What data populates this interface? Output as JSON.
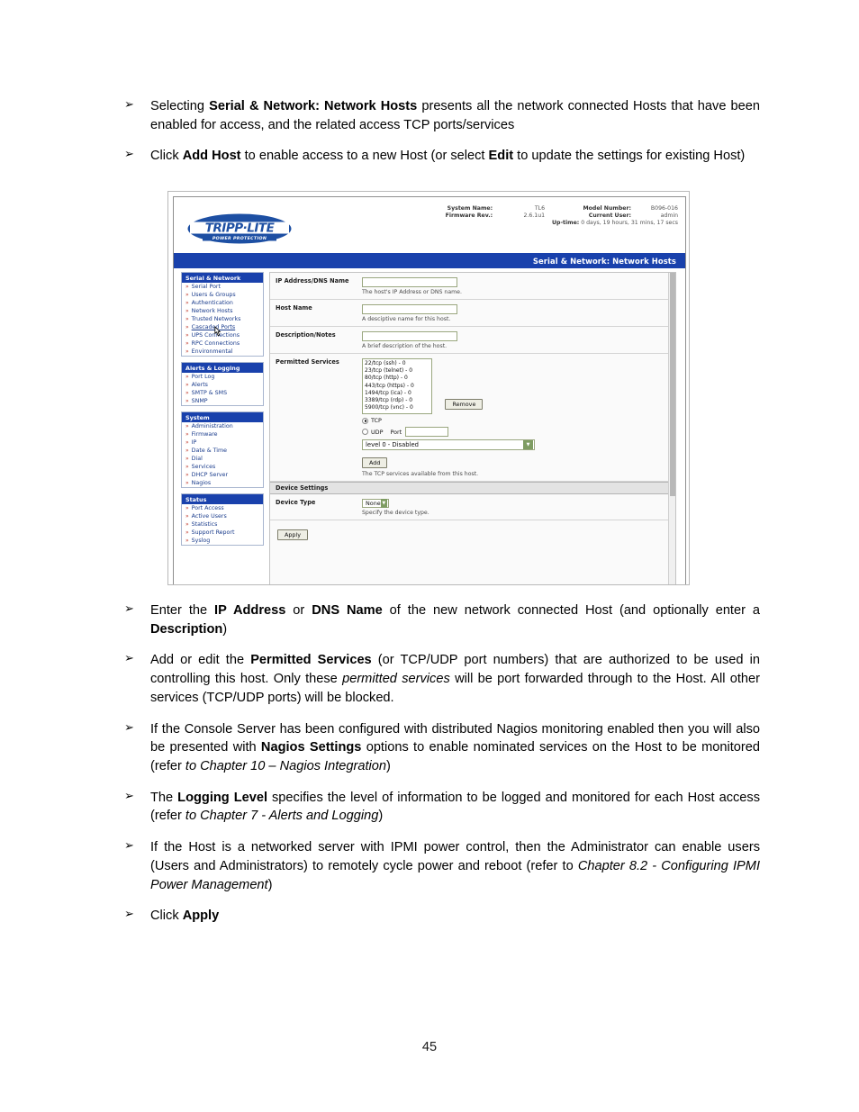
{
  "page": {
    "number": "45"
  },
  "bullets": [
    {
      "marker": "➢",
      "parts": [
        {
          "t": "Selecting ",
          "s": "n"
        },
        {
          "t": "Serial & Network: Network Hosts",
          "s": "b"
        },
        {
          "t": " presents all the network connected Hosts that have been enabled for access, and the related access TCP ports/services",
          "s": "n"
        }
      ]
    },
    {
      "marker": "➢",
      "parts": [
        {
          "t": "Click ",
          "s": "n"
        },
        {
          "t": "Add Host",
          "s": "b"
        },
        {
          "t": " to enable access to a new Host (or select ",
          "s": "n"
        },
        {
          "t": "Edit",
          "s": "b"
        },
        {
          "t": " to update the settings for existing Host)",
          "s": "n"
        }
      ]
    }
  ],
  "bullets_after": [
    {
      "marker": "➢",
      "parts": [
        {
          "t": "Enter the ",
          "s": "n"
        },
        {
          "t": "IP Address",
          "s": "b"
        },
        {
          "t": " or ",
          "s": "n"
        },
        {
          "t": "DNS Name",
          "s": "b"
        },
        {
          "t": " of the new network connected Host (and optionally enter a ",
          "s": "n"
        },
        {
          "t": "Description",
          "s": "b"
        },
        {
          "t": ")",
          "s": "n"
        }
      ]
    },
    {
      "marker": "➢",
      "parts": [
        {
          "t": "Add or edit the ",
          "s": "n"
        },
        {
          "t": "Permitted Services",
          "s": "b"
        },
        {
          "t": " (or TCP/UDP port numbers) that are authorized to be used in controlling this host. Only these ",
          "s": "n"
        },
        {
          "t": "permitted services",
          "s": "i"
        },
        {
          "t": " will be port forwarded through to the Host. All other services (TCP/UDP ports) will be blocked.",
          "s": "n"
        }
      ]
    },
    {
      "marker": "➢",
      "parts": [
        {
          "t": "If the Console Server has been configured with distributed Nagios monitoring enabled then you will also be presented with ",
          "s": "n"
        },
        {
          "t": "Nagios Settings",
          "s": "b"
        },
        {
          "t": " options to enable nominated services on the Host to be monitored (refer ",
          "s": "n"
        },
        {
          "t": "to Chapter 10 – Nagios Integration",
          "s": "i"
        },
        {
          "t": ")",
          "s": "n"
        }
      ]
    },
    {
      "marker": "➢",
      "parts": [
        {
          "t": "The ",
          "s": "n"
        },
        {
          "t": "Logging Level",
          "s": "b"
        },
        {
          "t": " specifies the level of information to be logged and monitored for each Host access (refer ",
          "s": "n"
        },
        {
          "t": "to Chapter 7 - Alerts and Logging",
          "s": "i"
        },
        {
          "t": ")",
          "s": "n"
        }
      ]
    },
    {
      "marker": "➢",
      "parts": [
        {
          "t": "If the Host is a networked server with IPMI power control, then the Administrator can enable users (Users and Administrators) to remotely cycle power and reboot (refer to ",
          "s": "n"
        },
        {
          "t": "Chapter 8.2 - Configuring IPMI Power Management",
          "s": "i"
        },
        {
          "t": ")",
          "s": "n"
        }
      ]
    },
    {
      "marker": "➢",
      "parts": [
        {
          "t": "Click ",
          "s": "n"
        },
        {
          "t": "Apply",
          "s": "b"
        }
      ]
    }
  ],
  "screenshot": {
    "brand": {
      "name": "TRIPP·LITE",
      "tagline": "POWER PROTECTION"
    },
    "system_info": {
      "system_name_label": "System Name:",
      "system_name_value": "TL6",
      "model_number_label": "Model Number:",
      "model_number_value": "B096-016",
      "firmware_label": "Firmware Rev.:",
      "firmware_value": "2.6.1u1",
      "current_user_label": "Current User:",
      "current_user_value": "admin",
      "uptime_label": "Up-time:",
      "uptime_value": "0 days, 19 hours, 31 mins, 17 secs"
    },
    "title_bar": "Serial & Network: Network Hosts",
    "sidebar": [
      {
        "header": "Serial & Network",
        "items": [
          {
            "label": "Serial Port",
            "hover": false
          },
          {
            "label": "Users & Groups",
            "hover": false
          },
          {
            "label": "Authentication",
            "hover": false
          },
          {
            "label": "Network Hosts",
            "hover": false
          },
          {
            "label": "Trusted Networks",
            "hover": false
          },
          {
            "label": "Cascaded Ports",
            "hover": true
          },
          {
            "label": "UPS Connections",
            "hover": false
          },
          {
            "label": "RPC Connections",
            "hover": false
          },
          {
            "label": "Environmental",
            "hover": false
          }
        ]
      },
      {
        "header": "Alerts & Logging",
        "items": [
          {
            "label": "Port Log",
            "hover": false
          },
          {
            "label": "Alerts",
            "hover": false
          },
          {
            "label": "SMTP & SMS",
            "hover": false
          },
          {
            "label": "SNMP",
            "hover": false
          }
        ]
      },
      {
        "header": "System",
        "items": [
          {
            "label": "Administration",
            "hover": false
          },
          {
            "label": "Firmware",
            "hover": false
          },
          {
            "label": "IP",
            "hover": false
          },
          {
            "label": "Date & Time",
            "hover": false
          },
          {
            "label": "Dial",
            "hover": false
          },
          {
            "label": "Services",
            "hover": false
          },
          {
            "label": "DHCP Server",
            "hover": false
          },
          {
            "label": "Nagios",
            "hover": false
          }
        ]
      },
      {
        "header": "Status",
        "items": [
          {
            "label": "Port Access",
            "hover": false
          },
          {
            "label": "Active Users",
            "hover": false
          },
          {
            "label": "Statistics",
            "hover": false
          },
          {
            "label": "Support Report",
            "hover": false
          },
          {
            "label": "Syslog",
            "hover": false
          }
        ]
      }
    ],
    "form": {
      "ip_label": "IP Address/DNS Name",
      "ip_value": "",
      "ip_hint": "The host's IP Address or DNS name.",
      "hostname_label": "Host Name",
      "hostname_value": "",
      "hostname_hint": "A desciptive name for this host.",
      "description_label": "Description/Notes",
      "description_value": "",
      "description_hint": "A brief description of the host.",
      "permitted_label": "Permitted Services",
      "permitted_services": [
        "22/tcp (ssh) - 0",
        "23/tcp (telnet) - 0",
        "80/tcp (http) - 0",
        "443/tcp (https) - 0",
        "1494/tcp (ica) - 0",
        "3389/tcp (rdp) - 0",
        "5900/tcp (vnc) - 0"
      ],
      "remove_button": "Remove",
      "tcp_label": "TCP",
      "udp_label": "UDP",
      "port_label": "Port",
      "port_value": "",
      "level_selected": "level 0 - Disabled",
      "add_button": "Add",
      "permitted_hint": "The TCP services available from this host."
    },
    "device_settings": {
      "header": "Device Settings",
      "device_type_label": "Device Type",
      "device_type_value": "None",
      "device_type_hint": "Specify the device type.",
      "apply_button": "Apply"
    },
    "colors": {
      "brand_blue": "#1941ac",
      "menu_link": "#1a3c8c",
      "bullet_dot": "#c0392b",
      "field_border": "#9aa77f"
    }
  }
}
